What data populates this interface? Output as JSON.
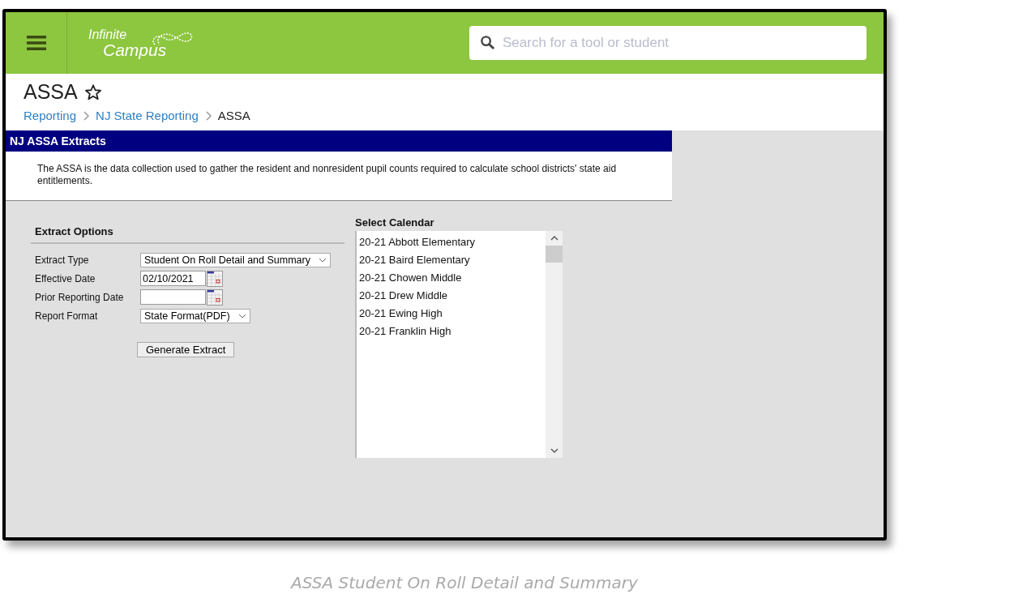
{
  "header": {
    "logo_line_1": "Infinite",
    "logo_line_2": "Campus",
    "search": {
      "placeholder": "Search for a tool or student"
    }
  },
  "page": {
    "title": "ASSA",
    "breadcrumbs": [
      "Reporting",
      "NJ State Reporting"
    ],
    "current": "ASSA"
  },
  "panel": {
    "title": "NJ ASSA Extracts",
    "description": "The ASSA is the data collection used to gather the resident and nonresident pupil counts required to calculate school districts' state aid entitlements."
  },
  "extract_options": {
    "title": "Extract Options",
    "fields": [
      {
        "kind": "select",
        "label": "Extract Type",
        "value": "Student On Roll Detail and Summary"
      },
      {
        "kind": "date",
        "label": "Effective Date",
        "value": "02/10/2021"
      },
      {
        "kind": "date",
        "label": "Prior Reporting Date"
      },
      {
        "kind": "select",
        "label": "Report Format",
        "value": "State Format(PDF)"
      }
    ],
    "button": "Generate Extract"
  },
  "calendar": {
    "title": "Select Calendar",
    "items": [
      "20-21 Abbott Elementary",
      "20-21 Baird Elementary",
      "20-21 Chowen Middle",
      "20-21 Drew Middle",
      "20-21 Ewing High",
      "20-21 Franklin High"
    ]
  },
  "caption": "ASSA Student On Roll Detail and Summary"
}
